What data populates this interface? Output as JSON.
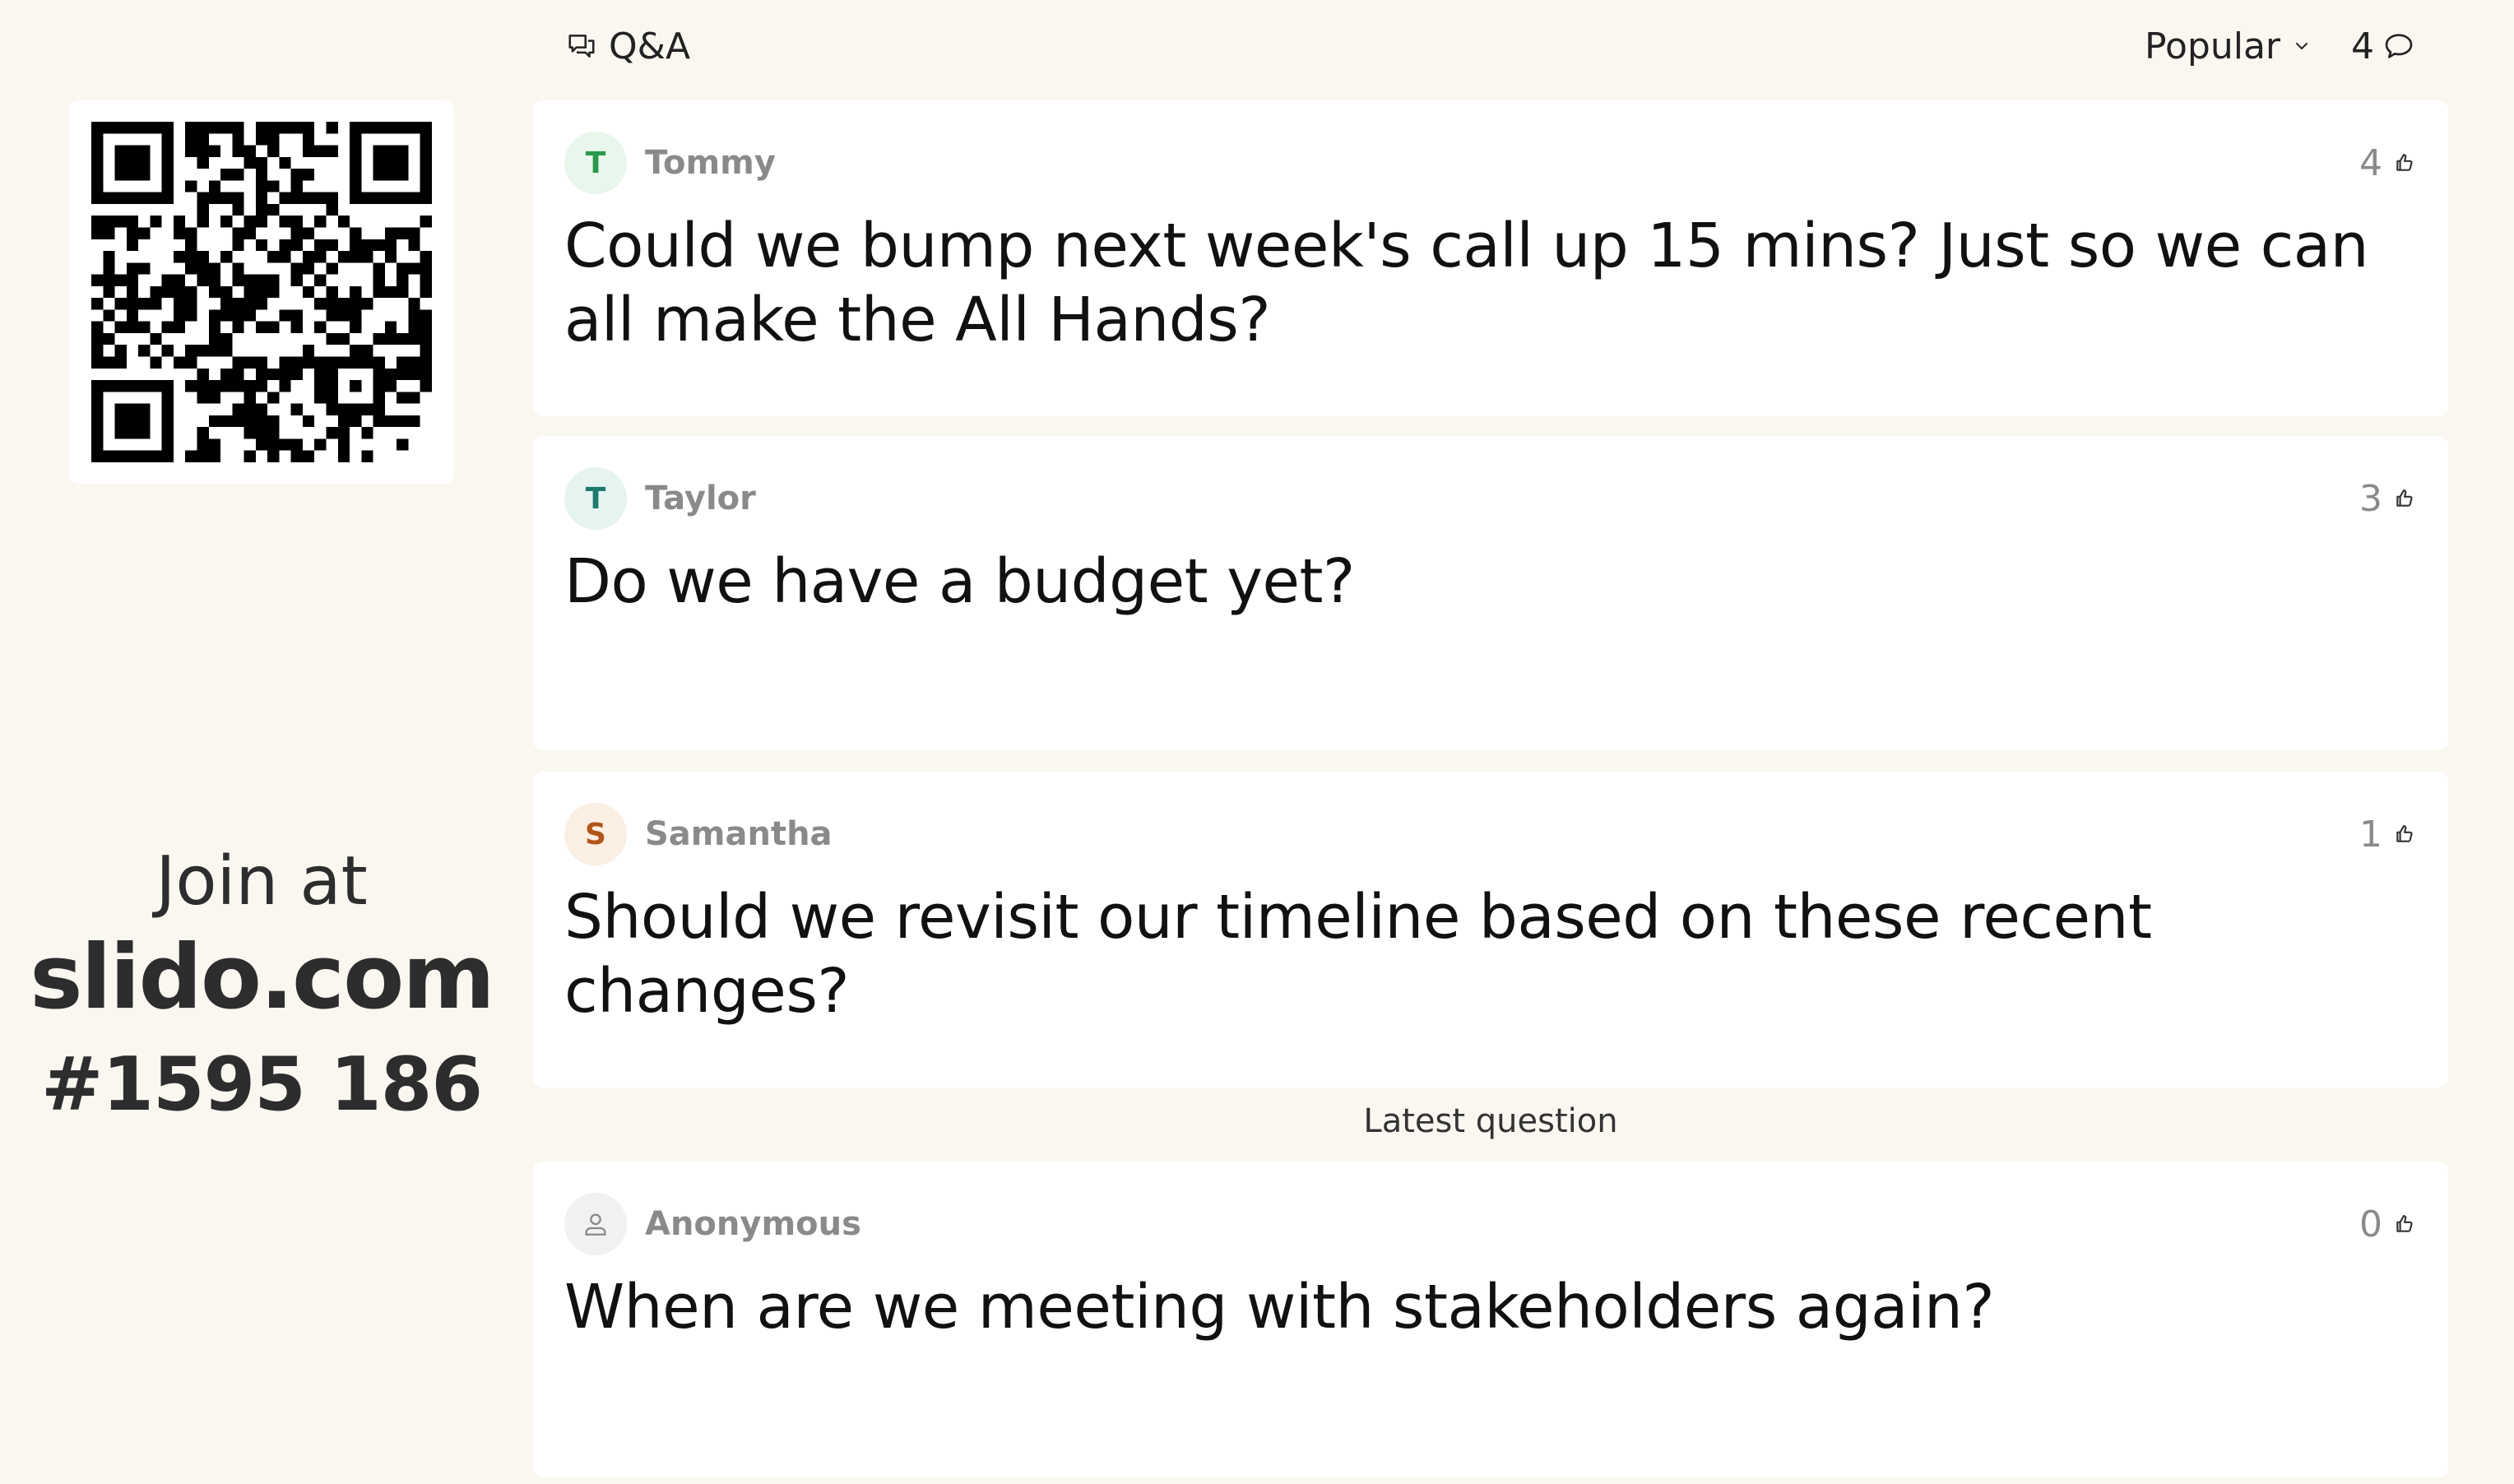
{
  "join": {
    "label": "Join at",
    "url": "slido.com",
    "code": "#1595 186"
  },
  "header": {
    "title": "Q&A",
    "title_icon": "speech-bubbles-icon",
    "sort_label": "Popular",
    "sort_icon": "chevron-down-icon",
    "question_count": "4",
    "count_icon": "speech-bubble-icon"
  },
  "questions": [
    {
      "author": "Tommy",
      "initial": "T",
      "avatar_bg": "#e8f6ec",
      "avatar_color": "#2a9a4a",
      "likes": "4",
      "text": "Could we bump next week's call up 15 mins? Just so we can all make the All Hands?"
    },
    {
      "author": "Taylor",
      "initial": "T",
      "avatar_bg": "#e5f4f1",
      "avatar_color": "#1f7a6e",
      "likes": "3",
      "text": "Do we have a budget yet?"
    },
    {
      "author": "Samantha",
      "initial": "S",
      "avatar_bg": "#fbeee2",
      "avatar_color": "#b0561a",
      "likes": "1",
      "text": "Should we revisit our timeline based on these recent changes?"
    }
  ],
  "latest_label": "Latest question",
  "latest_question": {
    "author": "Anonymous",
    "avatar_icon": "user-icon",
    "avatar_bg": "#f1f1f1",
    "likes": "0",
    "text": "When are we meeting with stakeholders again?"
  },
  "colors": {
    "background": "#faf7f0",
    "card": "#ffffff",
    "muted_text": "#8a8a8a"
  }
}
